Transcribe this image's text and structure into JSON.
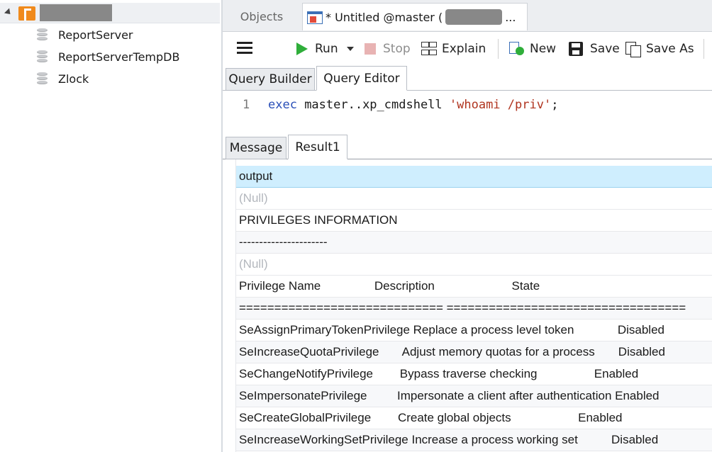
{
  "tree": {
    "databases": [
      "ReportServer",
      "ReportServerTempDB",
      "Zlock"
    ]
  },
  "tabs": {
    "objects_label": "Objects",
    "query_tab_label": "* Untitled @master (",
    "query_tab_suffix": "..."
  },
  "toolbar": {
    "run_label": "Run",
    "stop_label": "Stop",
    "explain_label": "Explain",
    "new_label": "New",
    "save_label": "Save",
    "saveas_label": "Save As"
  },
  "editor_tabs": {
    "query_builder": "Query Builder",
    "query_editor": "Query Editor"
  },
  "editor": {
    "line_number": "1",
    "code_keyword": "exec",
    "code_middle": " master..xp_cmdshell ",
    "code_string": "'whoami /priv'",
    "code_end": ";"
  },
  "result_tabs": {
    "message": "Message",
    "result1": "Result1"
  },
  "grid": {
    "column_header": "output",
    "rows": [
      "(Null)",
      "PRIVILEGES INFORMATION",
      "----------------------",
      "(Null)",
      "Privilege Name                Description                       State",
      "============================= ==================================",
      "SeAssignPrimaryTokenPrivilege Replace a process level token             Disabled",
      "SeIncreaseQuotaPrivilege       Adjust memory quotas for a process       Disabled",
      "SeChangeNotifyPrivilege        Bypass traverse checking                 Enabled",
      "SeImpersonatePrivilege         Impersonate a client after authentication Enabled",
      "SeCreateGlobalPrivilege        Create global objects                    Enabled",
      "SeIncreaseWorkingSetPrivilege Increase a process working set          Disabled"
    ]
  },
  "colors": {
    "selected_row": "#cfeefe",
    "run_green": "#2fae3a",
    "keyword_blue": "#2a4fb8",
    "string_red": "#b0341f"
  }
}
